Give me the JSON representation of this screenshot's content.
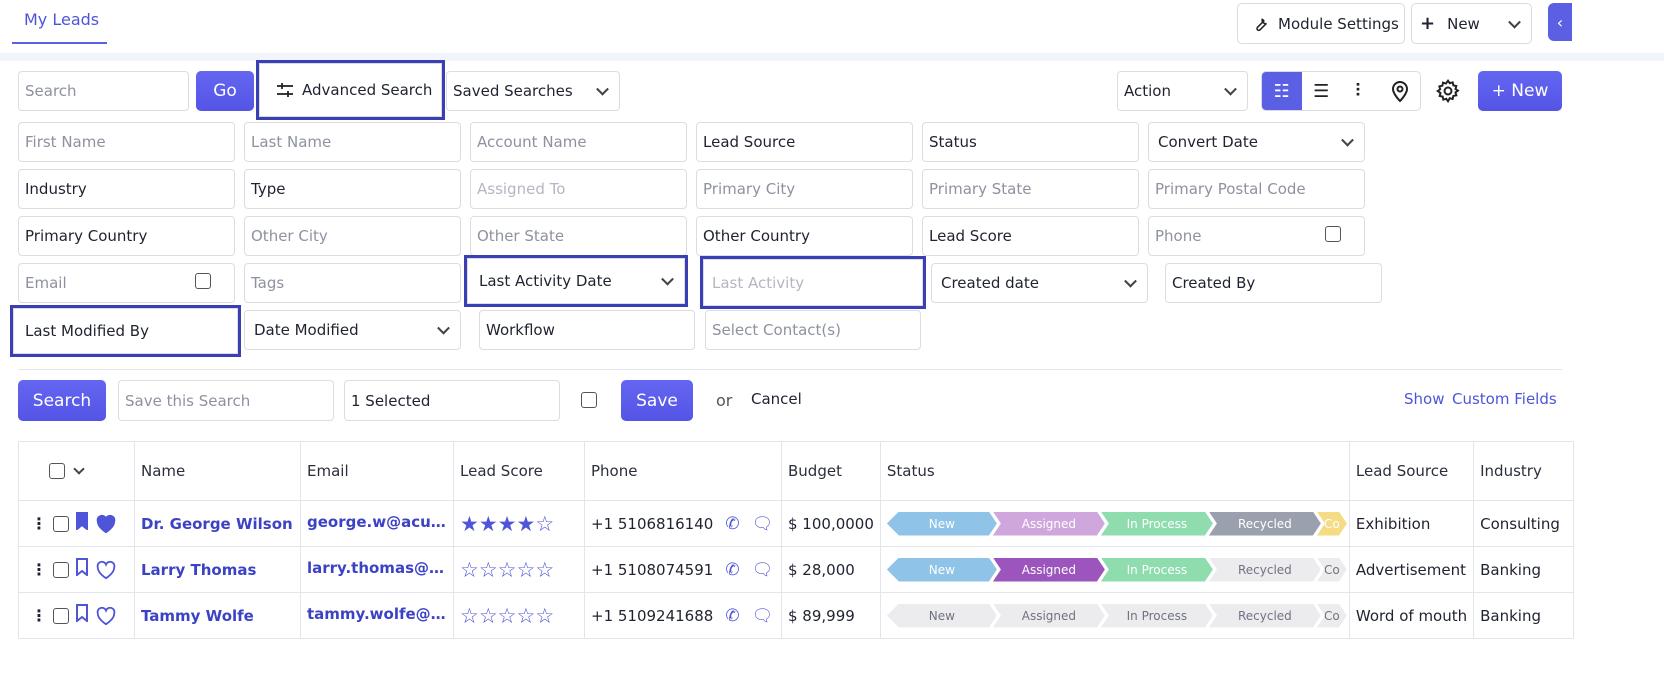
{
  "tab": {
    "label": "My Leads"
  },
  "header": {
    "module_settings_label": "Module Settings",
    "new_label": "New",
    "wrench_icon": "wrench-icon",
    "collapse_icon": "chevron-left-icon"
  },
  "toolbar": {
    "search_placeholder": "Search",
    "go_label": "Go",
    "advanced_search_label": "Advanced Search",
    "saved_searches_label": "Saved Searches",
    "action_label": "Action",
    "new_button_label": "+ New"
  },
  "filters": {
    "first_name": "First Name",
    "last_name": "Last Name",
    "account_name": "Account Name",
    "lead_source": "Lead Source",
    "status": "Status",
    "convert_date": "Convert Date",
    "industry": "Industry",
    "type": "Type",
    "assigned_to": "Assigned To",
    "primary_city": "Primary City",
    "primary_state": "Primary State",
    "primary_postal_code": "Primary Postal Code",
    "primary_country": "Primary Country",
    "other_city": "Other City",
    "other_state": "Other State",
    "other_country": "Other Country",
    "lead_score": "Lead Score",
    "phone": "Phone",
    "email": "Email",
    "tags": "Tags",
    "last_activity_date": "Last Activity Date",
    "last_activity": "Last Activity",
    "created_date": "Created date",
    "created_by": "Created By",
    "last_modified_by": "Last Modified By",
    "date_modified": "Date Modified",
    "workflow": "Workflow",
    "select_contacts": "Select Contact(s)"
  },
  "search_bar": {
    "search_label": "Search",
    "save_search_placeholder": "Save this Search",
    "selected_value": "1 Selected",
    "save_label": "Save",
    "or_label": "or",
    "cancel_label": "Cancel",
    "show_label": "Show",
    "custom_fields_label": "Custom Fields"
  },
  "table": {
    "headers": {
      "name": "Name",
      "email": "Email",
      "lead_score": "Lead Score",
      "phone": "Phone",
      "budget": "Budget",
      "status": "Status",
      "lead_source": "Lead Source",
      "industry": "Industry"
    },
    "stages": [
      "New",
      "Assigned",
      "In Process",
      "Recycled",
      "Co"
    ],
    "rows": [
      {
        "name": "Dr. George Wilson",
        "email": "george.w@acura...",
        "stars": 4,
        "phone": "+1 5106816140",
        "budget": "$ 100,0000",
        "lead_source": "Exhibition",
        "industry": "Consulting",
        "bookmarked": true,
        "favorite": true,
        "stage_colors": [
          "#8fc3e8",
          "#cfa7dc",
          "#8fdcae",
          "#9aa0ad",
          "#f3dc84"
        ]
      },
      {
        "name": "Larry Thomas",
        "email": "larry.thomas@yo...",
        "stars": 0,
        "phone": "+1 5108074591",
        "budget": "$ 28,000",
        "lead_source": "Advertisement",
        "industry": "Banking",
        "bookmarked": false,
        "favorite": false,
        "stage_colors": [
          "#8fc3e8",
          "#9b55bd",
          "#8fdcae",
          "#ececef",
          "#ececef"
        ]
      },
      {
        "name": "Tammy Wolfe",
        "email": "tammy.wolfe@y...",
        "stars": 0,
        "phone": "+1 5109241688",
        "budget": "$ 89,999",
        "lead_source": "Word of mouth",
        "industry": "Banking",
        "bookmarked": false,
        "favorite": false,
        "stage_colors": [
          "#ececef",
          "#ececef",
          "#ececef",
          "#ececef",
          "#ececef"
        ]
      }
    ]
  },
  "colors": {
    "accent": "#5a5fe4",
    "highlight_border": "#3b3fb4"
  }
}
